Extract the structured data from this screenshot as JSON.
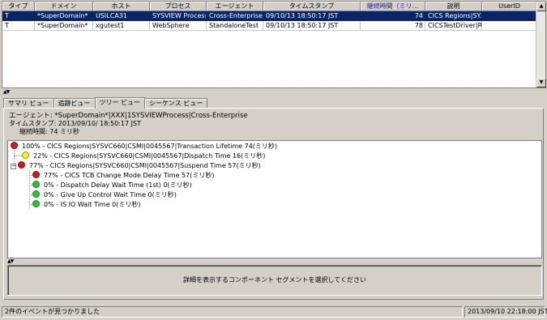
{
  "table": {
    "columns": [
      {
        "label": "タイプ",
        "sorted": false
      },
      {
        "label": "ドメイン",
        "sorted": false
      },
      {
        "label": "ホスト",
        "sorted": false
      },
      {
        "label": "プロセス",
        "sorted": false
      },
      {
        "label": "エージェント",
        "sorted": false
      },
      {
        "label": "タイムスタンプ",
        "sorted": false
      },
      {
        "label": "継続時間（ミリ...",
        "sorted": true
      },
      {
        "label": "説明",
        "sorted": false
      },
      {
        "label": "UserID",
        "sorted": false
      }
    ],
    "rows": [
      {
        "selected": true,
        "cells": [
          "T",
          "*SuperDomain*",
          "USILCA31",
          "SYSVIEW Process",
          "Cross-Enterprise",
          "09/10/13 18:50:17 JST",
          "74",
          "CICS Regions|SY...",
          ""
        ]
      },
      {
        "selected": false,
        "cells": [
          "T",
          "*SuperDomain*",
          "xgutest1",
          "WebSphere",
          "StandaloneTest",
          "09/10/13 18:50:17 JST",
          "78",
          "CICSTestDriver|R...",
          ""
        ]
      }
    ]
  },
  "tabs": [
    {
      "label": "サマリ ビュー",
      "active": false
    },
    {
      "label": "追跡ビュー",
      "active": false
    },
    {
      "label": "ツリー ビュー",
      "active": true
    },
    {
      "label": "シーケンス ビュー",
      "active": false
    }
  ],
  "info": {
    "agent": "エージェント: *SuperDomain*|XXX|1SYSVIEWProcess|Cross-Enterprise",
    "timestamp": "タイムスタンプ: 2013/09/10/ 18:50:17 JST",
    "duration": "継続時間: 74 ミリ秒"
  },
  "tree": {
    "nodes": [
      {
        "label": "100% - CICS Regions|SYSVC660|CSMI|0045567|Transaction Lifetime 74(ミリ秒)",
        "color": "#cc1a1a",
        "expander": ""
      },
      {
        "label": "22% - CICS Regions|SYSVC660|CSMI|0045567|Dispatch Time 16(ミリ秒)",
        "color": "#f5f01e",
        "expander": ""
      },
      {
        "label": "77% - CICS Regions|SYSVC660|CSMI|0045567|Suspend Time 57(ミリ秒)",
        "color": "#cc1a1a",
        "expander": "−"
      },
      {
        "label": "77% - CICS TCB Change Mode Delay Time 57(ミリ秒)",
        "color": "#cc1a1a",
        "expander": ""
      },
      {
        "label": "0% - Dispatch Delay Wait Time (1st) 0(ミリ秒)",
        "color": "#2dc42d",
        "expander": ""
      },
      {
        "label": "0% - Give Up Control Wait Time 0(ミリ秒)",
        "color": "#2dc42d",
        "expander": ""
      },
      {
        "label": "0% - IS IO Wait Time 0(ミリ秒)",
        "color": "#2dc42d",
        "expander": ""
      }
    ]
  },
  "detail_message": "詳細を表示するコンポーネント セグメントを選択してください",
  "status": {
    "left": "2件のイベントが見つかりました",
    "right": "2013/09/10 22:18:00 JST"
  }
}
